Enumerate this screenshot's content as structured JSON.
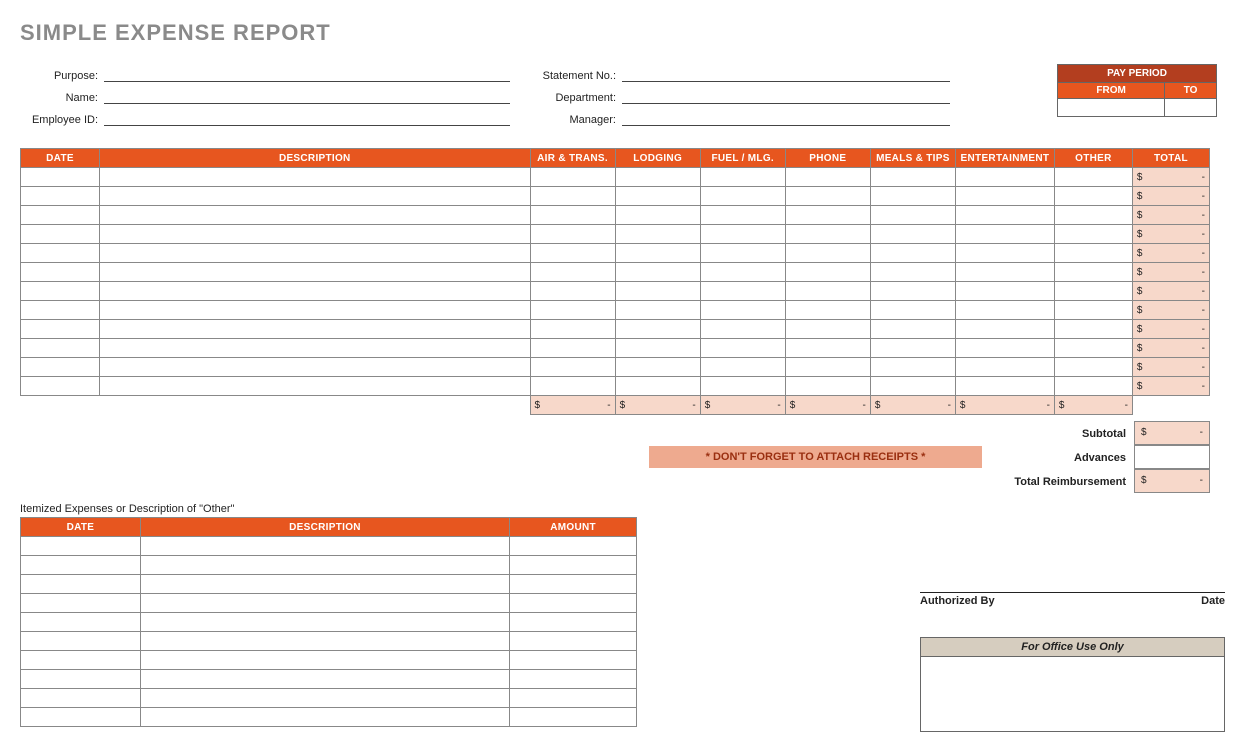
{
  "title": "SIMPLE EXPENSE REPORT",
  "info_left": {
    "purpose_label": "Purpose:",
    "name_label": "Name:",
    "employee_id_label": "Employee ID:"
  },
  "info_right": {
    "statement_no_label": "Statement No.:",
    "department_label": "Department:",
    "manager_label": "Manager:"
  },
  "pay_period": {
    "header": "PAY PERIOD",
    "from_label": "FROM",
    "to_label": "TO"
  },
  "main_headers": {
    "date": "DATE",
    "description": "DESCRIPTION",
    "air_trans": "AIR & TRANS.",
    "lodging": "LODGING",
    "fuel_mlg": "FUEL / MLG.",
    "phone": "PHONE",
    "meals_tips": "MEALS & TIPS",
    "entertainment": "ENTERTAINMENT",
    "other": "OTHER",
    "total": "TOTAL"
  },
  "row_total_display": {
    "dollar": "$",
    "dash": "-"
  },
  "col_sum_display": {
    "dollar": "$",
    "dash": "-"
  },
  "summary": {
    "subtotal_label": "Subtotal",
    "advances_label": "Advances",
    "total_reimbursement_label": "Total Reimbursement",
    "dollar": "$",
    "dash": "-"
  },
  "receipt_reminder": "* DON'T FORGET TO ATTACH RECEIPTS *",
  "itemized": {
    "caption": "Itemized Expenses or Description of \"Other\"",
    "headers": {
      "date": "DATE",
      "description": "DESCRIPTION",
      "amount": "AMOUNT"
    }
  },
  "signature": {
    "authorized_by_label": "Authorized By",
    "date_label": "Date"
  },
  "office_use": {
    "header": "For Office Use Only"
  }
}
